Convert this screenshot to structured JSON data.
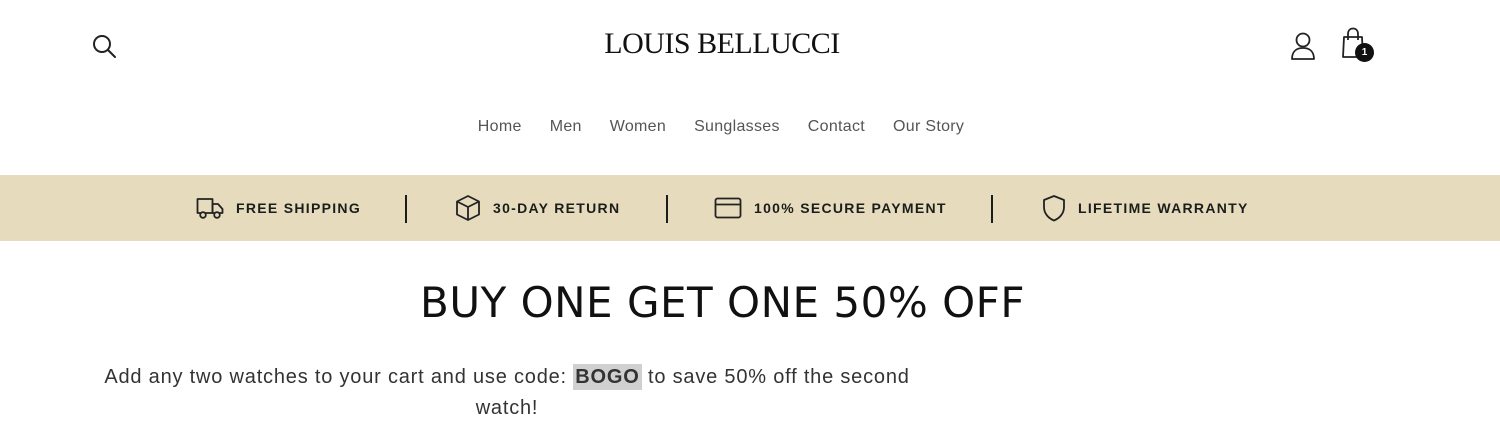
{
  "header": {
    "brand": "LOUIS BELLUCCI",
    "cart_count": "1"
  },
  "nav": {
    "items": [
      "Home",
      "Men",
      "Women",
      "Sunglasses",
      "Contact",
      "Our Story"
    ]
  },
  "trust_bar": {
    "background": "#e6dcbd",
    "items": [
      {
        "icon": "truck-icon",
        "label": "FREE SHIPPING"
      },
      {
        "icon": "box-icon",
        "label": "30-DAY RETURN"
      },
      {
        "icon": "credit-card-icon",
        "label": "100% SECURE PAYMENT"
      },
      {
        "icon": "shield-icon",
        "label": "LIFETIME WARRANTY"
      }
    ]
  },
  "promo": {
    "title": "BUY ONE GET ONE 50% OFF",
    "text_before": "Add any two watches to your cart and use code: ",
    "code": "BOGO",
    "text_after": " to save 50% off the second watch!"
  }
}
